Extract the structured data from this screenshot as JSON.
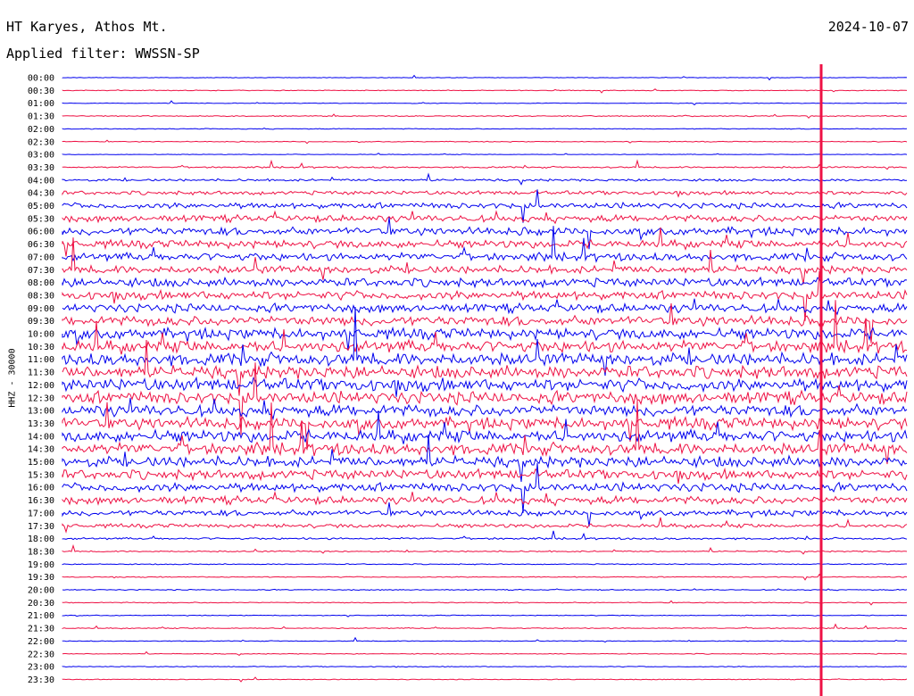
{
  "header": {
    "station": "HT Karyes, Athos Mt.",
    "filter": "Applied filter: WWSSN-SP",
    "date": "2024-10-07"
  },
  "chart_data": {
    "type": "line",
    "title": "HT Karyes, Athos Mt.",
    "subtitle": "Applied filter: WWSSN-SP",
    "date": "2024-10-07",
    "ylabel": "HHZ - 30000",
    "time_labels": [
      "00:00",
      "00:30",
      "01:00",
      "01:30",
      "02:00",
      "02:30",
      "03:00",
      "03:30",
      "04:00",
      "04:30",
      "05:00",
      "05:30",
      "06:00",
      "06:30",
      "07:00",
      "07:30",
      "08:00",
      "08:30",
      "09:00",
      "09:30",
      "10:00",
      "10:30",
      "11:00",
      "11:30",
      "12:00",
      "12:30",
      "13:00",
      "13:30",
      "14:00",
      "14:30",
      "15:00",
      "15:30",
      "16:00",
      "16:30",
      "17:00",
      "17:30",
      "18:00",
      "18:30",
      "19:00",
      "19:30",
      "20:00",
      "20:30",
      "21:00",
      "21:30",
      "22:00",
      "22:30",
      "23:00",
      "23:30"
    ],
    "noise_levels": [
      0.3,
      0.4,
      0.3,
      0.5,
      0.4,
      0.4,
      0.3,
      0.8,
      1.2,
      2.0,
      3.0,
      3.5,
      4.0,
      4.0,
      4.0,
      4.0,
      4.5,
      4.5,
      4.5,
      5.0,
      5.5,
      6.0,
      6.5,
      6.5,
      6.5,
      6.5,
      6.0,
      6.0,
      6.0,
      6.0,
      5.5,
      5.0,
      4.5,
      4.0,
      3.0,
      2.0,
      1.0,
      0.7,
      0.5,
      0.5,
      0.5,
      0.5,
      0.4,
      0.5,
      0.4,
      0.4,
      0.4,
      0.4
    ],
    "colors": [
      "#0000ee",
      "#ee1144"
    ],
    "marker_color": "#ee1144"
  }
}
